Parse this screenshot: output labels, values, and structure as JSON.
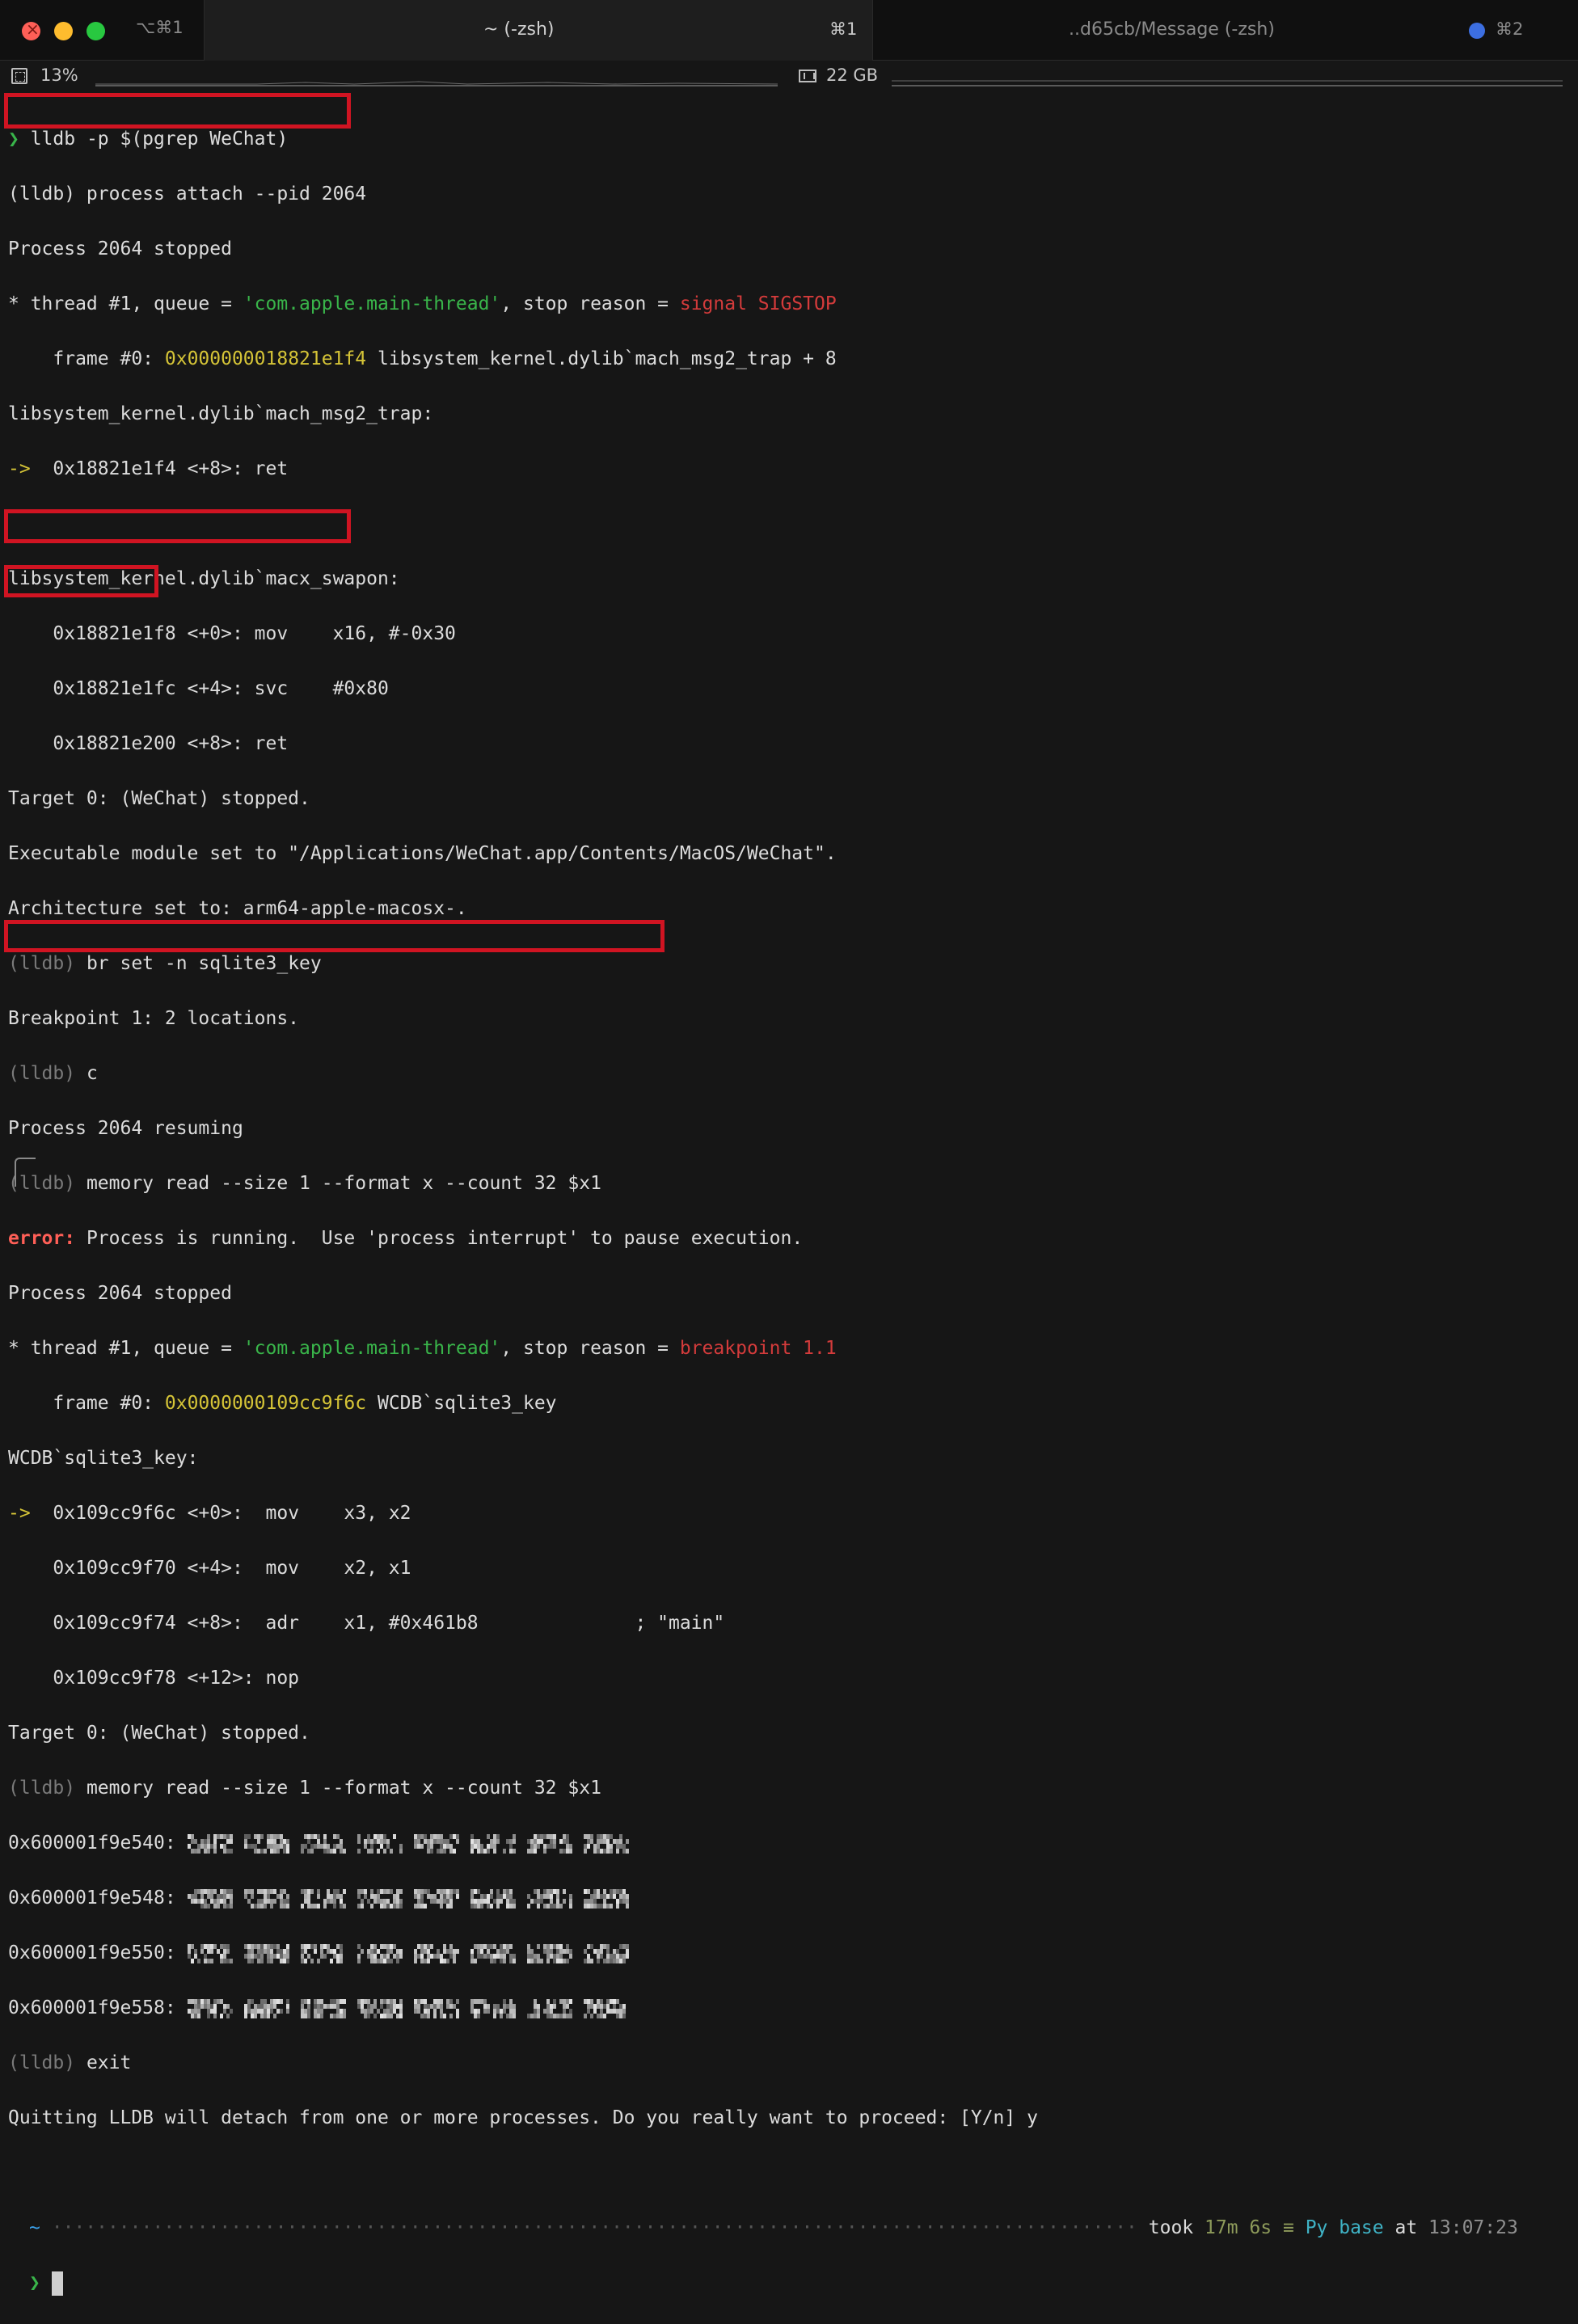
{
  "tabs": [
    {
      "label": "",
      "shortcut": "⌥⌘1"
    },
    {
      "label": "~ (-zsh)",
      "shortcut": "⌘1"
    },
    {
      "label": "..d65cb/Message (-zsh)",
      "shortcut": "⌘2"
    }
  ],
  "status": {
    "cpu": "13%",
    "memory": "22 GB"
  },
  "colors": {
    "highlight": "#d01422",
    "prompt": "#39b54a",
    "error": "#ff5f57"
  },
  "terminal": {
    "lines": [
      "❯ lldb -p $(pgrep WeChat)",
      "(lldb) process attach --pid 2064",
      "Process 2064 stopped",
      "* thread #1, queue = 'com.apple.main-thread', stop reason = signal SIGSTOP",
      "    frame #0: 0x000000018821e1f4 libsystem_kernel.dylib`mach_msg2_trap + 8",
      "libsystem_kernel.dylib`mach_msg2_trap:",
      "->  0x18821e1f4 <+8>: ret",
      "",
      "libsystem_kernel.dylib`macx_swapon:",
      "    0x18821e1f8 <+0>: mov    x16, #-0x30",
      "    0x18821e1fc <+4>: svc    #0x80",
      "    0x18821e200 <+8>: ret",
      "Target 0: (WeChat) stopped.",
      "Executable module set to \"/Applications/WeChat.app/Contents/MacOS/WeChat\".",
      "Architecture set to: arm64-apple-macosx-.",
      "(lldb) br set -n sqlite3_key",
      "Breakpoint 1: 2 locations.",
      "(lldb) c",
      "Process 2064 resuming",
      "(lldb) memory read --size 1 --format x --count 32 $x1",
      "error: Process is running.  Use 'process interrupt' to pause execution.",
      "Process 2064 stopped",
      "* thread #1, queue = 'com.apple.main-thread', stop reason = breakpoint 1.1",
      "    frame #0: 0x0000000109cc9f6c WCDB`sqlite3_key",
      "WCDB`sqlite3_key:",
      "->  0x109cc9f6c <+0>:  mov    x3, x2",
      "    0x109cc9f70 <+4>:  mov    x2, x1",
      "    0x109cc9f74 <+8>:  adr    x1, #0x461b8              ; \"main\"",
      "    0x109cc9f78 <+12>: nop",
      "Target 0: (WeChat) stopped.",
      "(lldb) memory read --size 1 --format x --count 32 $x1",
      "0x600001f9e540:",
      "0x600001f9e548:",
      "0x600001f9e550:",
      "0x600001f9e558:",
      "(lldb) exit",
      "Quitting LLDB will detach from one or more processes. Do you really want to proceed: [Y/n] y"
    ],
    "prompt": {
      "dir": "~",
      "took_label": "took",
      "took_value": "17m 6s",
      "env_symbol": "≡",
      "env_name": "Py base",
      "at_label": "at",
      "time": "13:07:23",
      "caret": "❯"
    }
  }
}
